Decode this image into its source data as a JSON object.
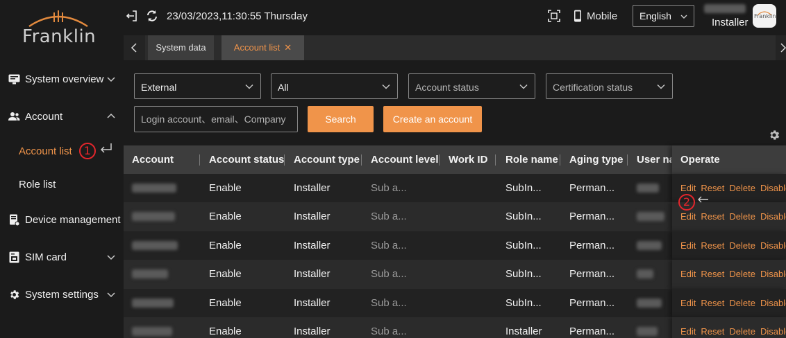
{
  "brand": {
    "logo_text": "Franklin",
    "avatar_text": "Franklin"
  },
  "sidebar": {
    "items": [
      {
        "label": "System overview",
        "icon": "monitor-icon",
        "expanded": false
      },
      {
        "label": "Account",
        "icon": "users-icon",
        "expanded": true
      },
      {
        "label": "Device management",
        "icon": "device-icon",
        "expanded": null
      },
      {
        "label": "SIM card",
        "icon": "sim-card-icon",
        "expanded": false
      },
      {
        "label": "System settings",
        "icon": "gear-icon",
        "expanded": false
      }
    ],
    "sub_items": [
      {
        "label": "Account list",
        "active": true
      },
      {
        "label": "Role list",
        "active": false
      }
    ]
  },
  "annotations": {
    "marker_1": "1",
    "marker_2": "2"
  },
  "header": {
    "datetime": "23/03/2023,11:30:55 Thursday",
    "mobile_label": "Mobile",
    "language": "English",
    "user_role": "Installer"
  },
  "tabs": [
    {
      "label": "System data",
      "active": false
    },
    {
      "label": "Account list",
      "active": true,
      "closable": true
    }
  ],
  "filters": {
    "selects": [
      {
        "value": "External",
        "is_placeholder": false
      },
      {
        "value": "All",
        "is_placeholder": false
      },
      {
        "value": "Account status",
        "is_placeholder": true
      },
      {
        "value": "Certification status",
        "is_placeholder": true
      }
    ],
    "search_placeholder": "Login account、email、Company",
    "search_button": "Search",
    "create_button": "Create an account"
  },
  "table": {
    "columns": [
      "Account",
      "Account status",
      "Account type",
      "Account level",
      "Work ID",
      "Role name",
      "Aging type",
      "User nai",
      "Operate"
    ],
    "rows": [
      {
        "status": "Enable",
        "type": "Installer",
        "level": "Sub a...",
        "work_id": "",
        "role": "SubIn...",
        "aging": "Perman..."
      },
      {
        "status": "Enable",
        "type": "Installer",
        "level": "Sub a...",
        "work_id": "",
        "role": "SubIn...",
        "aging": "Perman..."
      },
      {
        "status": "Enable",
        "type": "Installer",
        "level": "Sub a...",
        "work_id": "",
        "role": "SubIn...",
        "aging": "Perman..."
      },
      {
        "status": "Enable",
        "type": "Installer",
        "level": "Sub a...",
        "work_id": "",
        "role": "SubIn...",
        "aging": "Perman..."
      },
      {
        "status": "Enable",
        "type": "Installer",
        "level": "Sub a...",
        "work_id": "",
        "role": "SubIn...",
        "aging": "Perman..."
      },
      {
        "status": "Enable",
        "type": "Installer",
        "level": "Sub a...",
        "work_id": "",
        "role": "Installer",
        "aging": "Perman..."
      }
    ],
    "operations": [
      "Edit",
      "Reset",
      "Delete",
      "Disable"
    ]
  },
  "colors": {
    "accent": "#f0944a",
    "annotation": "#e5262c",
    "background": "#1b1b1b"
  }
}
